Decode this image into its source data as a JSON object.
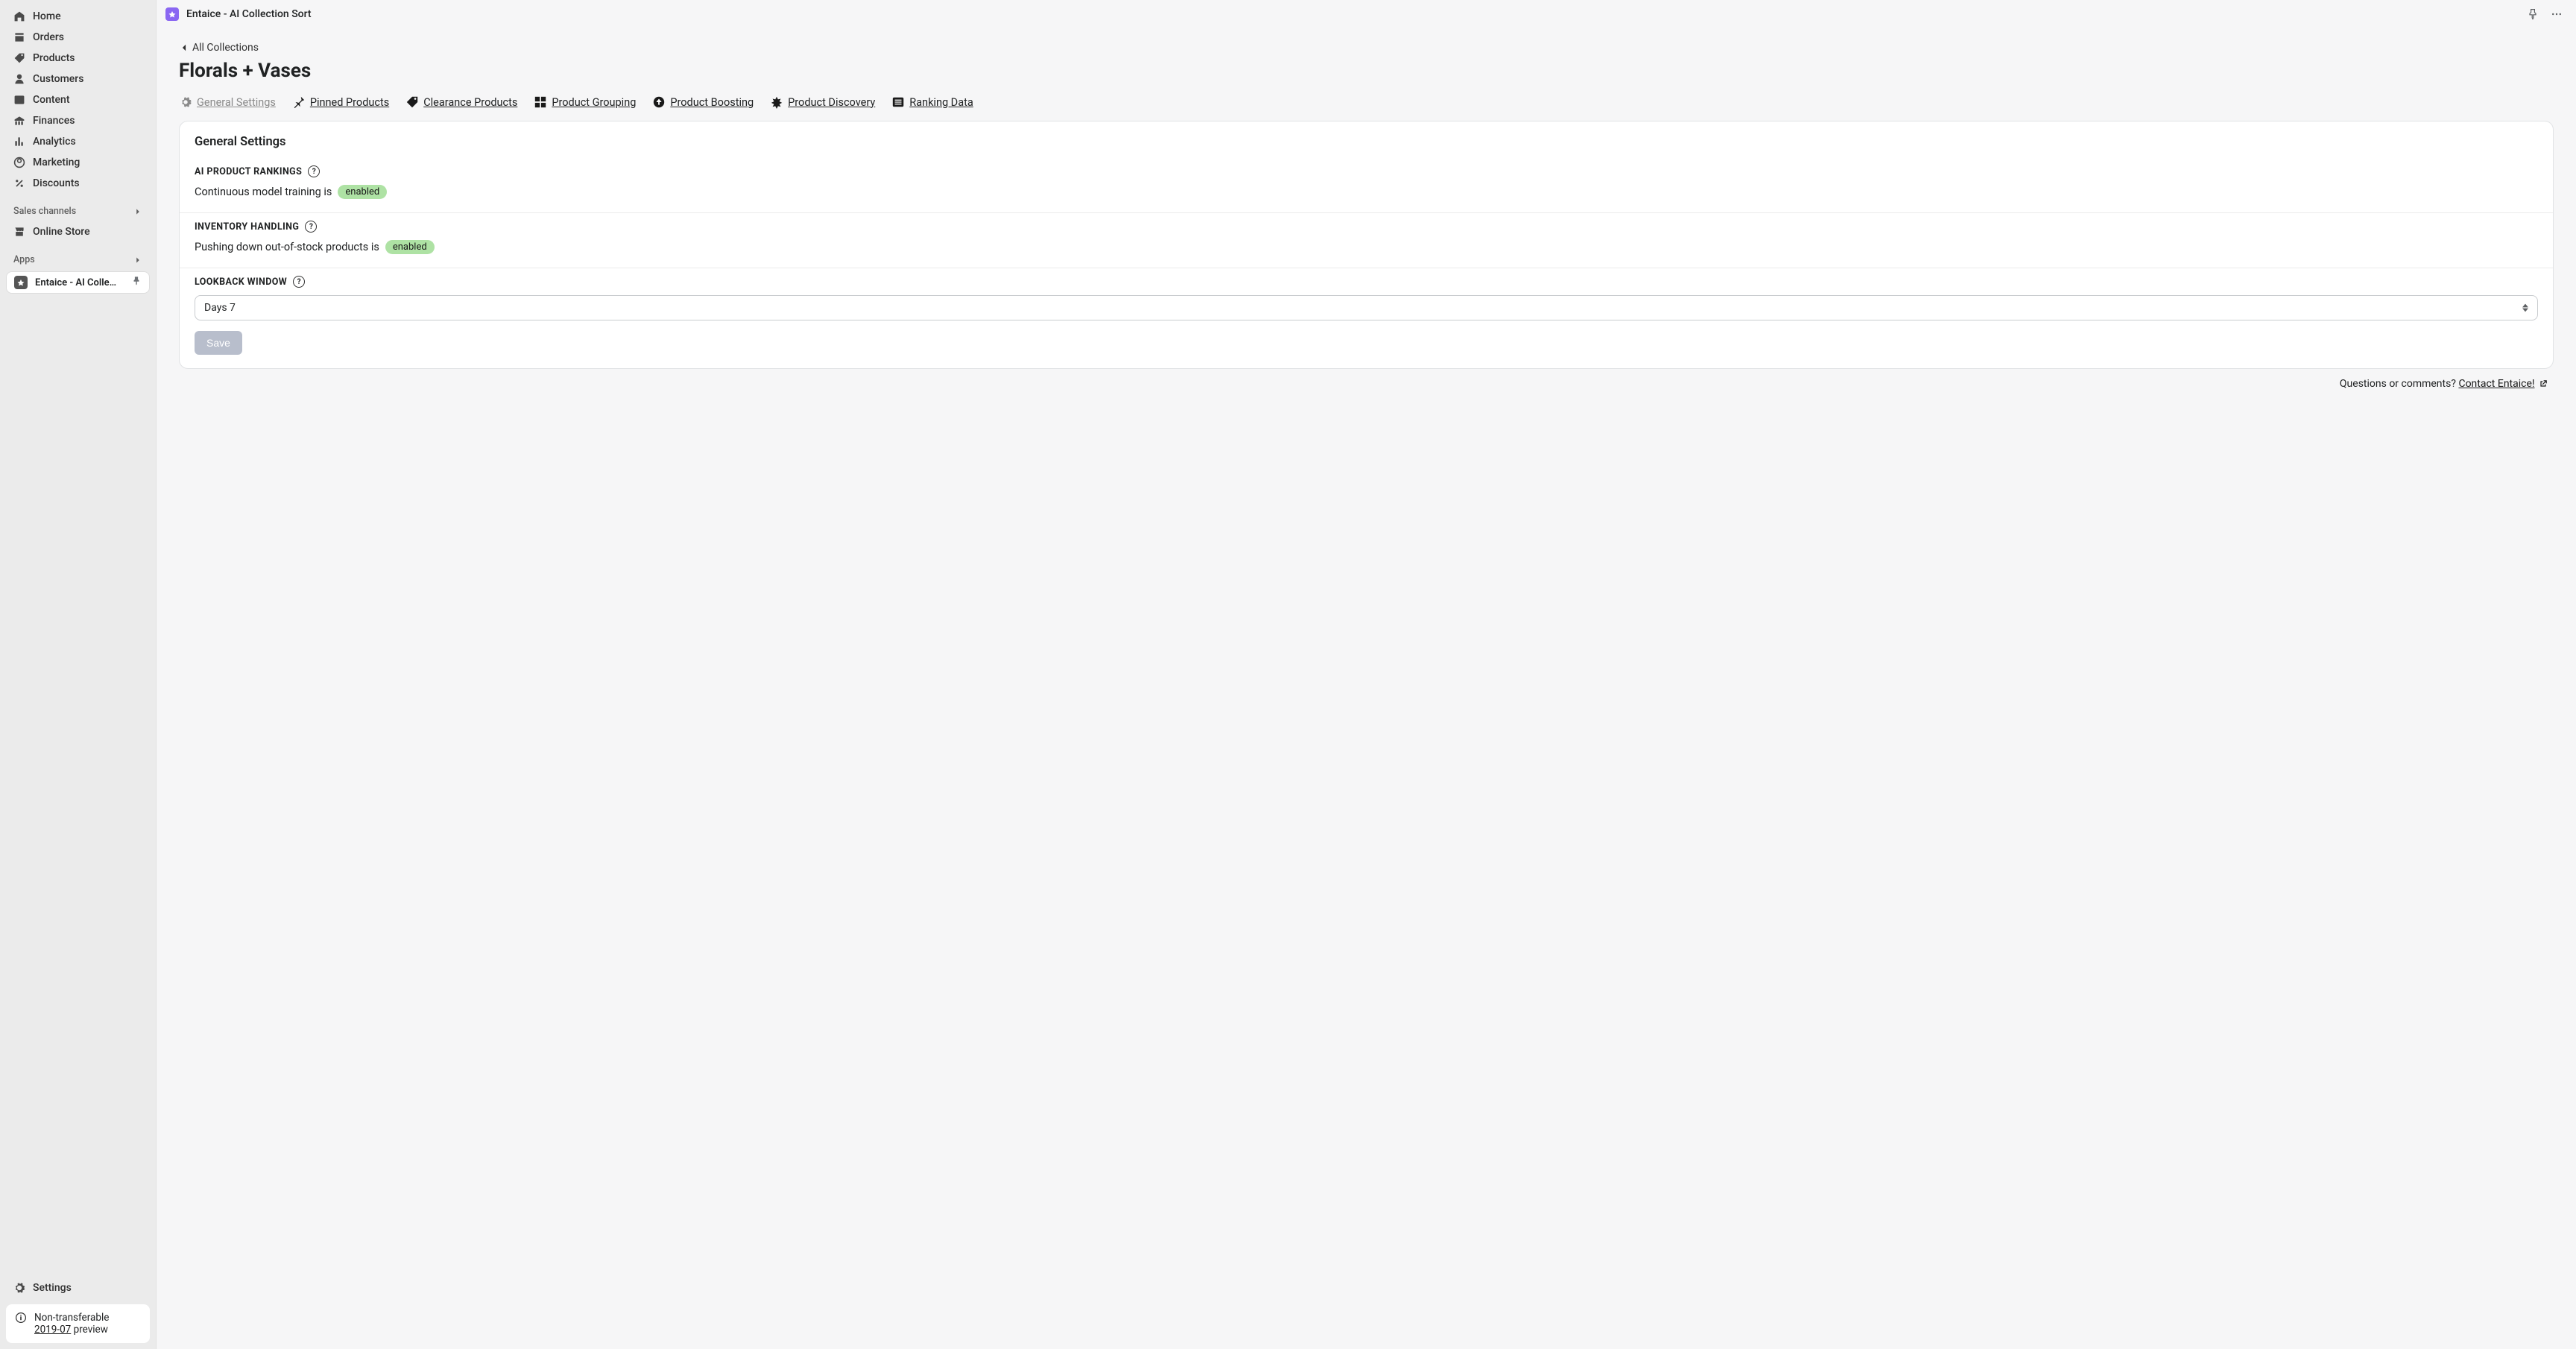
{
  "topbar": {
    "title": "Entaice - AI Collection Sort"
  },
  "sidebar": {
    "nav": [
      {
        "label": "Home"
      },
      {
        "label": "Orders"
      },
      {
        "label": "Products"
      },
      {
        "label": "Customers"
      },
      {
        "label": "Content"
      },
      {
        "label": "Finances"
      },
      {
        "label": "Analytics"
      },
      {
        "label": "Marketing"
      },
      {
        "label": "Discounts"
      }
    ],
    "salesChannelsHeader": "Sales channels",
    "channels": [
      {
        "label": "Online Store"
      }
    ],
    "appsHeader": "Apps",
    "apps": [
      {
        "label": "Entaice - AI Collection..."
      }
    ],
    "settings": "Settings",
    "preview": {
      "line1": "Non-transferable",
      "version": "2019-07",
      "suffix": " preview"
    }
  },
  "breadcrumb": "All Collections",
  "pageTitle": "Florals + Vases",
  "tabs": [
    {
      "label": "General Settings"
    },
    {
      "label": "Pinned Products"
    },
    {
      "label": "Clearance Products"
    },
    {
      "label": "Product Grouping"
    },
    {
      "label": "Product Boosting"
    },
    {
      "label": "Product Discovery"
    },
    {
      "label": "Ranking Data"
    }
  ],
  "card": {
    "title": "General Settings",
    "ai": {
      "label": "AI PRODUCT RANKINGS",
      "text": "Continuous model training is",
      "status": "enabled"
    },
    "inv": {
      "label": "INVENTORY HANDLING",
      "text": "Pushing down out-of-stock products is",
      "status": "enabled"
    },
    "lookback": {
      "label": "LOOKBACK WINDOW",
      "selected": "Days 7"
    },
    "saveLabel": "Save"
  },
  "footer": {
    "question": "Questions or comments? ",
    "link": "Contact Entaice!"
  }
}
